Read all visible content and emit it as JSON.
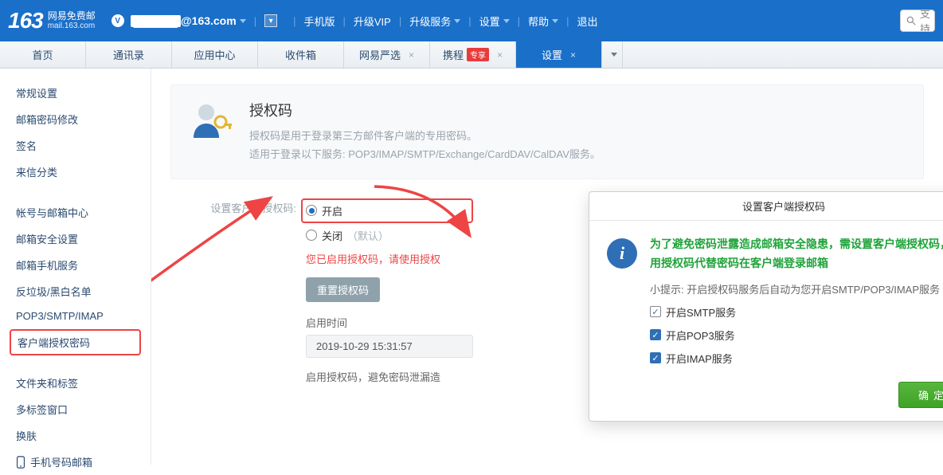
{
  "brand": {
    "logo": "163",
    "name": "网易免费邮",
    "domain": "mail.163.com"
  },
  "account": {
    "email_suffix": "@163.com"
  },
  "topmenu": {
    "mobile": "手机版",
    "upgrade_vip": "升级VIP",
    "upgrade_service": "升级服务",
    "settings": "设置",
    "help": "帮助",
    "logout": "退出"
  },
  "search": {
    "placeholder": "支持"
  },
  "tabs": {
    "home": "首页",
    "contacts": "通讯录",
    "app_center": "应用中心",
    "inbox": "收件箱",
    "yanxuan": "网易严选",
    "xiecheng": "携程",
    "xiecheng_badge": "专享",
    "settings": "设置"
  },
  "sidebar": {
    "g1": {
      "general": "常规设置",
      "pwd_mod": "邮箱密码修改",
      "signature": "签名",
      "letter_sort": "来信分类"
    },
    "g2": {
      "account_center": "帐号与邮箱中心",
      "security": "邮箱安全设置",
      "mobile_service": "邮箱手机服务",
      "antispam": "反垃圾/黑白名单",
      "pop3": "POP3/SMTP/IMAP",
      "client_auth": "客户端授权密码"
    },
    "g3": {
      "folders": "文件夹和标签",
      "multitab": "多标签窗口",
      "skin": "换肤",
      "phone_mail": "手机号码邮箱"
    }
  },
  "hero": {
    "title": "授权码",
    "line1": "授权码是用于登录第三方邮件客户端的专用密码。",
    "line2": "适用于登录以下服务: POP3/IMAP/SMTP/Exchange/CardDAV/CalDAV服务。"
  },
  "form": {
    "label": "设置客户端授权码:",
    "on": "开启",
    "off": "关闭",
    "off_default": "（默认）",
    "warn": "您已启用授权码，请使用授权",
    "reset_btn": "重置授权码",
    "enable_time_label": "启用时间",
    "enable_time": "2019-10-29 15:31:57",
    "enable_tip": "启用授权码，避免密码泄漏造"
  },
  "dialog": {
    "title": "设置客户端授权码",
    "msg": "为了避免密码泄露造成邮箱安全隐患，需设置客户端授权码，用授权码代替密码在客户端登录邮箱",
    "hint": "小提示: 开启授权码服务后自动为您开启SMTP/POP3/IMAP服务",
    "chk_smtp": "开启SMTP服务",
    "chk_pop3": "开启POP3服务",
    "chk_imap": "开启IMAP服务",
    "ok": "确定"
  }
}
